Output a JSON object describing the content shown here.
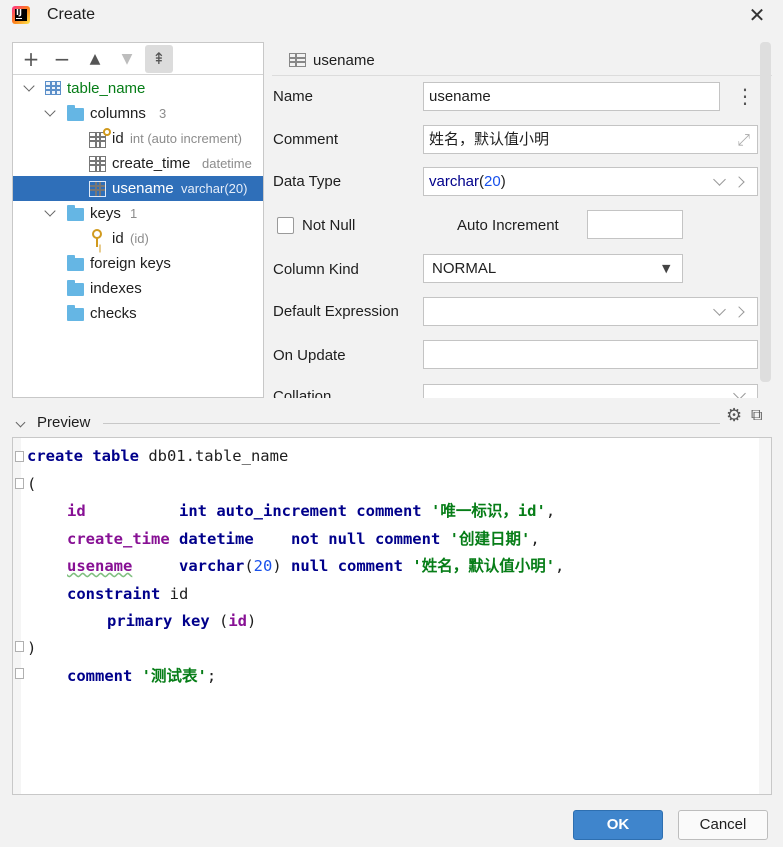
{
  "window": {
    "title": "Create",
    "app_icon": "intellij-idea-icon",
    "close_glyph": "✕"
  },
  "tree": {
    "toolbar": {
      "add": "+",
      "remove": "−",
      "up": "▲",
      "down": "▼",
      "pin": "⇞"
    },
    "table": {
      "label": "table_name"
    },
    "columns": {
      "label": "columns",
      "count": "3"
    },
    "column_items": [
      {
        "name": "id",
        "type": "int (auto increment)"
      },
      {
        "name": "create_time",
        "type": "datetime"
      },
      {
        "name": "usename",
        "type": "varchar(20)"
      }
    ],
    "keys": {
      "label": "keys",
      "count": "1"
    },
    "key_items": [
      {
        "name": "id",
        "type": "(id)"
      }
    ],
    "foreign_keys": "foreign keys",
    "indexes": "indexes",
    "checks": "checks"
  },
  "props": {
    "header": "usename",
    "name_label": "Name",
    "name_value": "usename",
    "more_glyph": "⋮",
    "comment_label": "Comment",
    "comment_value": "姓名，默认值小明",
    "expand_glyph": "⤢",
    "datatype_label": "Data Type",
    "datatype_type": "varchar",
    "datatype_open": "(",
    "datatype_len": "20",
    "datatype_close": ")",
    "notnull_label": "Not Null",
    "autoinc_label": "Auto Increment",
    "kind_label": "Column Kind",
    "kind_value": "NORMAL",
    "kind_arrow": "▼",
    "default_label": "Default Expression",
    "onupdate_label": "On Update",
    "collation_label": "Collation"
  },
  "preview": {
    "label": "Preview",
    "gear_glyph": "⚙",
    "external_glyph": "⧉",
    "code": {
      "l1_kw": "create table",
      "l1_rest": " db01.table_name",
      "l2": "(",
      "l3_col": "id",
      "l3_type": "int auto_increment comment",
      "l3_str": "'唯一标识，id'",
      "l3_end": ",",
      "l4_col": "create_time",
      "l4_kw": "datetime    not null comment",
      "l4_str": "'创建日期'",
      "l4_end": ",",
      "l5_col": "usename",
      "l5_kw1": "varchar",
      "l5_p1": "(",
      "l5_num": "20",
      "l5_p2": ")",
      "l5_kw2": "null comment",
      "l5_str": "'姓名，默认值小明'",
      "l5_end": ",",
      "l6_kw": "constraint",
      "l6_rest": " id",
      "l7_kw": "primary key",
      "l7_p1": " (",
      "l7_col": "id",
      "l7_p2": ")",
      "l8": ")",
      "l9_kw": "comment",
      "l9_str": "'测试表'",
      "l9_end": ";"
    }
  },
  "buttons": {
    "ok": "OK",
    "cancel": "Cancel"
  }
}
